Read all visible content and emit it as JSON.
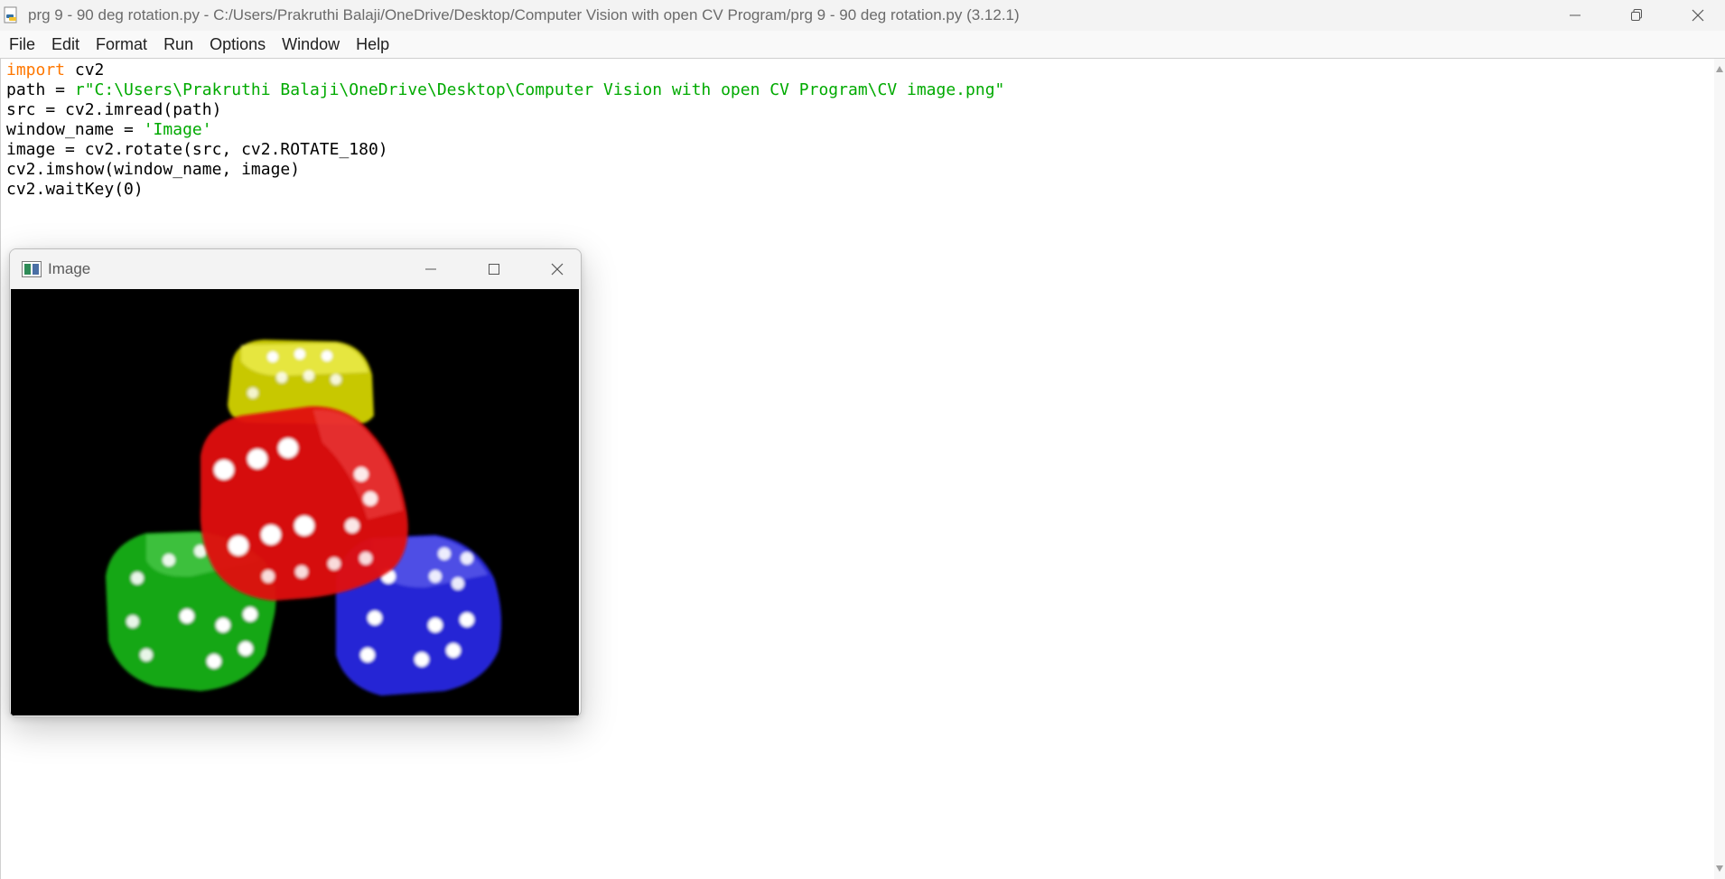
{
  "titlebar": {
    "title": "prg 9 - 90 deg rotation.py - C:/Users/Prakruthi Balaji/OneDrive/Desktop/Computer Vision with open CV Program/prg 9 - 90 deg rotation.py (3.12.1)",
    "icon": "python-file-icon"
  },
  "menubar": {
    "items": [
      "File",
      "Edit",
      "Format",
      "Run",
      "Options",
      "Window",
      "Help"
    ]
  },
  "code": {
    "lines": [
      {
        "kw": "import",
        "rest": " cv2"
      },
      {
        "pre": "path = ",
        "str": "r\"C:\\Users\\Prakruthi Balaji\\OneDrive\\Desktop\\Computer Vision with open CV Program\\CV image.png\""
      },
      {
        "plain": "src = cv2.imread(path)"
      },
      {
        "pre": "window_name = ",
        "str": "'Image'"
      },
      {
        "plain": "image = cv2.rotate(src, cv2.ROTATE_180)"
      },
      {
        "plain": "cv2.imshow(window_name, image)"
      },
      {
        "plain": "cv2.waitKey(0)"
      }
    ]
  },
  "image_window": {
    "title": "Image",
    "content": "rotated-dice-image"
  },
  "colors": {
    "keyword": "#ff7700",
    "string": "#00aa00",
    "dice": [
      "#e3e000",
      "#e01010",
      "#10b010",
      "#2a2ae0"
    ]
  }
}
